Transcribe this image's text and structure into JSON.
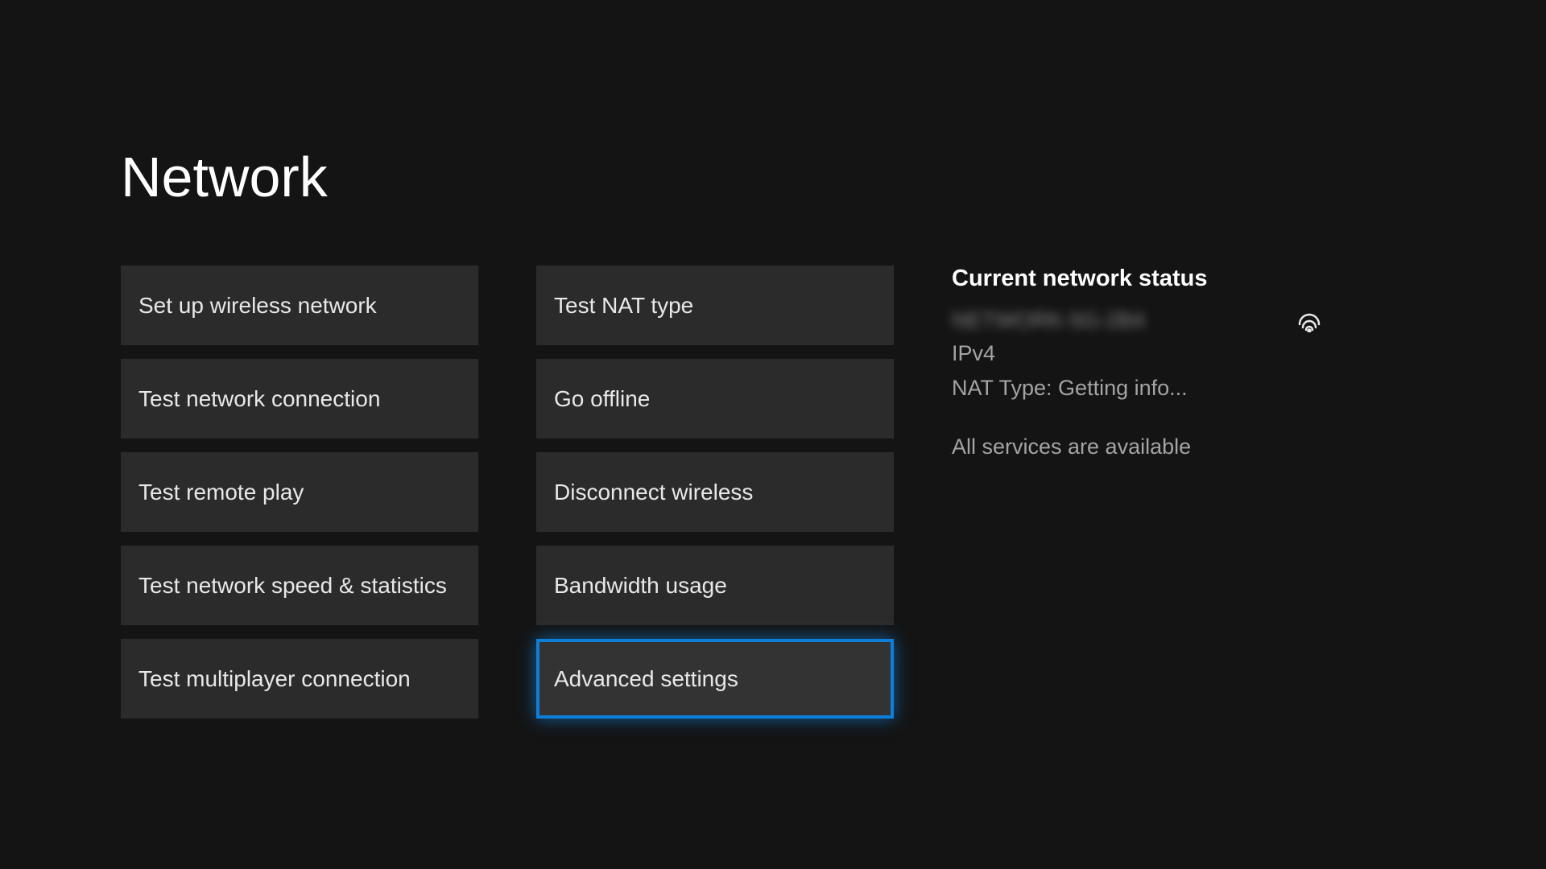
{
  "page": {
    "title": "Network"
  },
  "column1": {
    "items": [
      {
        "label": "Set up wireless network"
      },
      {
        "label": "Test network connection"
      },
      {
        "label": "Test remote play"
      },
      {
        "label": "Test network speed & statistics"
      },
      {
        "label": "Test multiplayer connection"
      }
    ]
  },
  "column2": {
    "items": [
      {
        "label": "Test NAT type"
      },
      {
        "label": "Go offline"
      },
      {
        "label": "Disconnect wireless"
      },
      {
        "label": "Bandwidth usage"
      },
      {
        "label": "Advanced settings"
      }
    ],
    "selected_index": 4
  },
  "status": {
    "heading": "Current network status",
    "network_name": "NETWORK-5G-2B4",
    "ip_version": "IPv4",
    "nat_type": "NAT Type: Getting info...",
    "services": "All services are available"
  }
}
